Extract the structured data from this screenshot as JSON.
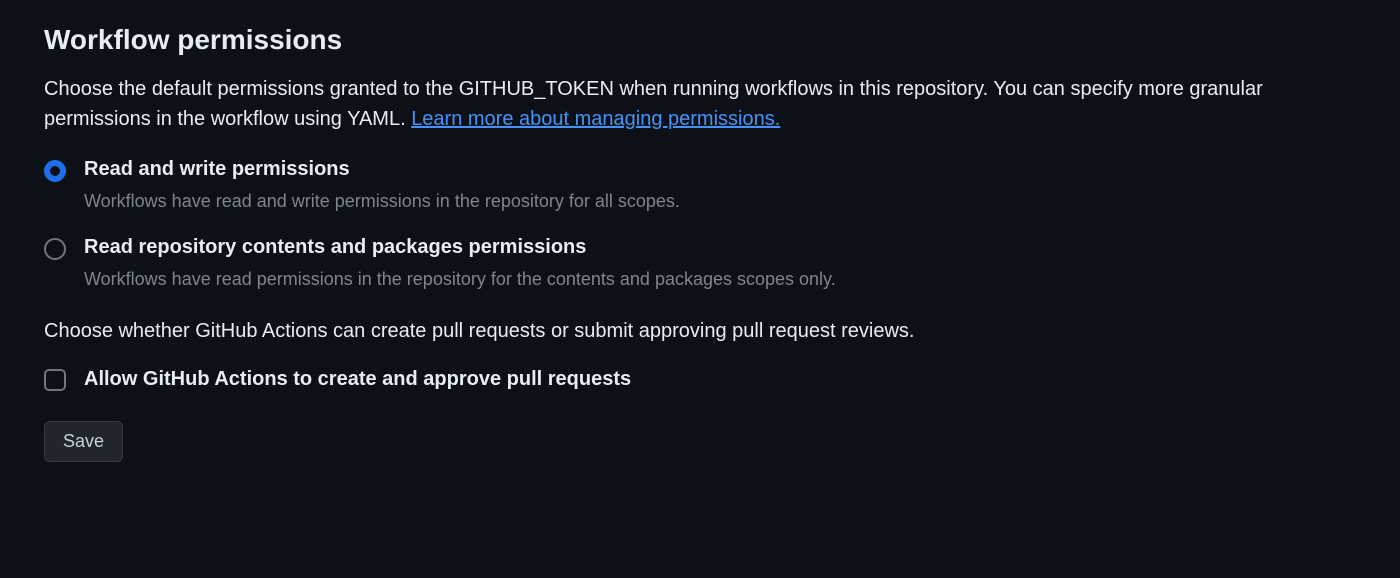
{
  "section": {
    "title": "Workflow permissions",
    "description_part1": "Choose the default permissions granted to the GITHUB_TOKEN when running workflows in this repository. You can specify more granular permissions in the workflow using YAML. ",
    "learn_more_link": "Learn more about managing permissions."
  },
  "permissions": {
    "read_write": {
      "label": "Read and write permissions",
      "hint": "Workflows have read and write permissions in the repository for all scopes.",
      "selected": true
    },
    "read_only": {
      "label": "Read repository contents and packages permissions",
      "hint": "Workflows have read permissions in the repository for the contents and packages scopes only.",
      "selected": false
    }
  },
  "pr_section": {
    "description": "Choose whether GitHub Actions can create pull requests or submit approving pull request reviews.",
    "checkbox_label": "Allow GitHub Actions to create and approve pull requests",
    "checked": false
  },
  "actions": {
    "save_label": "Save"
  }
}
